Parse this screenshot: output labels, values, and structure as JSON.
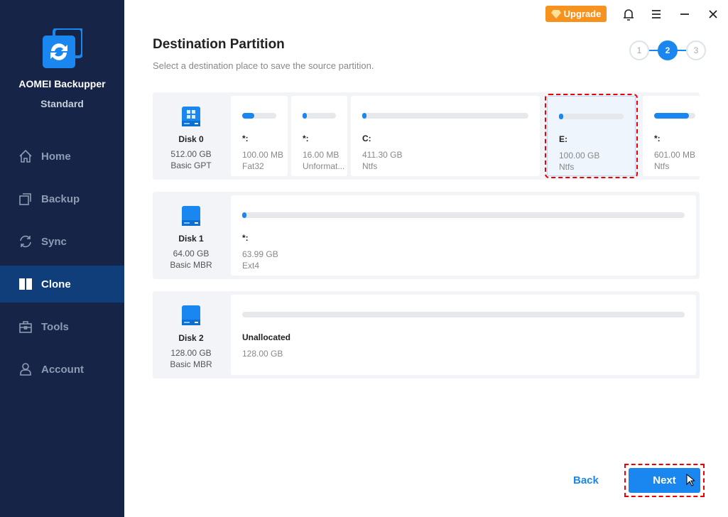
{
  "app": {
    "name": "AOMEI Backupper",
    "edition": "Standard"
  },
  "nav": [
    {
      "label": "Home",
      "icon": "home-icon"
    },
    {
      "label": "Backup",
      "icon": "backup-icon"
    },
    {
      "label": "Sync",
      "icon": "sync-icon"
    },
    {
      "label": "Clone",
      "icon": "clone-icon",
      "active": true
    },
    {
      "label": "Tools",
      "icon": "tools-icon"
    },
    {
      "label": "Account",
      "icon": "account-icon"
    }
  ],
  "topbar": {
    "upgrade": "Upgrade"
  },
  "page": {
    "title": "Destination Partition",
    "subtitle": "Select a destination place to save the source partition."
  },
  "steps": [
    "1",
    "2",
    "3"
  ],
  "current_step": 2,
  "disks": [
    {
      "name": "Disk 0",
      "size": "512.00 GB",
      "type": "Basic GPT",
      "partitions": [
        {
          "label": "*:",
          "size": "100.00 MB",
          "fs": "Fat32",
          "used": 0.35
        },
        {
          "label": "*:",
          "size": "16.00 MB",
          "fs": "Unformat...",
          "used": 0.05
        },
        {
          "label": "C:",
          "size": "411.30 GB",
          "fs": "Ntfs",
          "used": 0.02
        },
        {
          "label": "E:",
          "size": "100.00 GB",
          "fs": "Ntfs",
          "used": 0.03,
          "selected": true
        },
        {
          "label": "*:",
          "size": "601.00 MB",
          "fs": "Ntfs",
          "used": 0.85
        }
      ]
    },
    {
      "name": "Disk 1",
      "size": "64.00 GB",
      "type": "Basic MBR",
      "partitions": [
        {
          "label": "*:",
          "size": "63.99 GB",
          "fs": "Ext4",
          "used": 0.01
        }
      ]
    },
    {
      "name": "Disk 2",
      "size": "128.00 GB",
      "type": "Basic MBR",
      "partitions": [
        {
          "label": "Unallocated",
          "size": "128.00 GB",
          "fs": "",
          "used": 0
        }
      ]
    }
  ],
  "footer": {
    "back": "Back",
    "next": "Next"
  },
  "colors": {
    "sidebar": "#152447",
    "accent": "#1a86ef",
    "upgrade": "#f6921e",
    "selection": "#e00000"
  }
}
